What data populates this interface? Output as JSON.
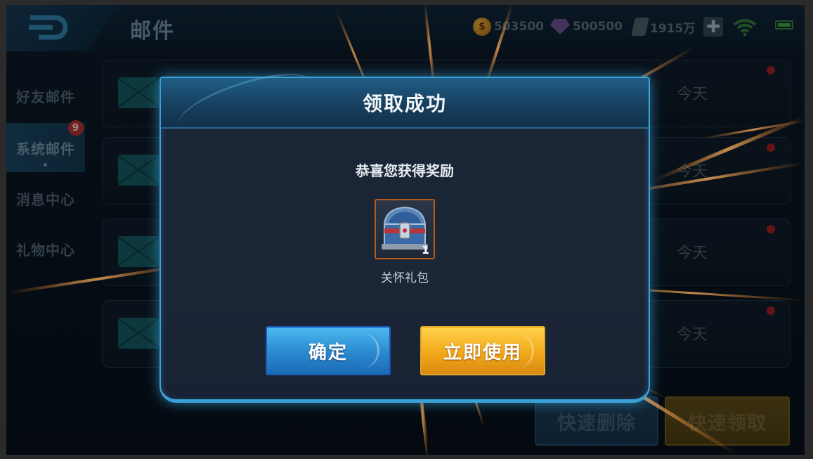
{
  "topbar": {
    "title": "邮件",
    "gold": "503500",
    "diamonds": "500500",
    "crystals": "1915万",
    "plus": "✚"
  },
  "sidebar": {
    "items": [
      {
        "label": "好友邮件"
      },
      {
        "label": "系统邮件",
        "badge": "9"
      },
      {
        "label": "消息中心"
      },
      {
        "label": "礼物中心"
      }
    ]
  },
  "mail_list": {
    "rows": [
      {
        "date": "今天"
      },
      {
        "date": "今天"
      },
      {
        "date": "今天"
      },
      {
        "date": "今天"
      }
    ]
  },
  "actions": {
    "quick_delete": "快速删除",
    "quick_claim": "快速领取"
  },
  "dialog": {
    "title": "领取成功",
    "message": "恭喜您获得奖励",
    "reward": {
      "icon": "treasure-chest-icon",
      "count": "1",
      "name": "关怀礼包"
    },
    "confirm_label": "确定",
    "use_label": "立即使用"
  },
  "colors": {
    "dialog_border": "#3aa2d8",
    "confirm_button": "#2a88cf",
    "use_button": "#f2a81a",
    "badge": "#b23030"
  }
}
